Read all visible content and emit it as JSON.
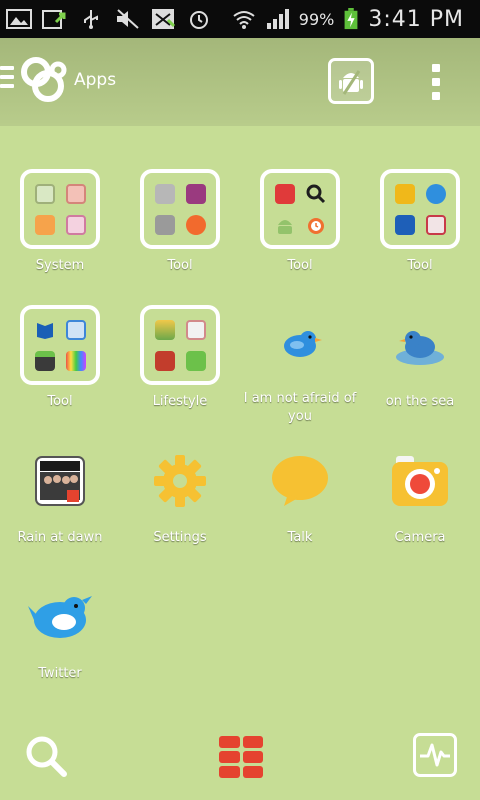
{
  "status_bar": {
    "battery": "99%",
    "time": "3:41 PM",
    "icons": [
      "gallery-icon",
      "upload-icon",
      "usb-icon",
      "mute-icon",
      "notification-icon",
      "alarm-icon",
      "wifi-icon",
      "signal-icon",
      "battery-charging-icon"
    ]
  },
  "action_bar": {
    "title": "Apps",
    "icons": [
      "menu-icon",
      "go-launcher-logo-icon",
      "app-store-icon",
      "overflow-menu-icon"
    ]
  },
  "apps": [
    {
      "label": "System",
      "kind": "folder",
      "minis": [
        "#d9e8c4",
        "#f3c1b7",
        "#f6a34b",
        "#f4d2e0"
      ]
    },
    {
      "label": "Tool",
      "kind": "folder",
      "minis": [
        "#b7b7b7",
        "#9a3a7f",
        "#9a9a9a",
        "#f26a2d"
      ]
    },
    {
      "label": "Tool",
      "kind": "folder",
      "minis": [
        "#e03a3a",
        "#1e1e1e",
        "#93c36b",
        "#f07030"
      ]
    },
    {
      "label": "Tool",
      "kind": "folder",
      "minis": [
        "#f0b81a",
        "#2f8fde",
        "#1e5fb8",
        "#c83a48"
      ]
    },
    {
      "label": "Tool",
      "kind": "folder",
      "minis": [
        "#1a5fb6",
        "#3d86d8",
        "#3a3a3a",
        "#d8d8d8"
      ]
    },
    {
      "label": "Lifestyle",
      "kind": "folder",
      "minis": [
        "#e0b633",
        "#e2a0a0",
        "#c23d2c",
        "#6cc14a"
      ]
    },
    {
      "label": "I am not afraid of you",
      "kind": "app",
      "icon": "blue-bird-icon"
    },
    {
      "label": "on the sea",
      "kind": "app",
      "icon": "sea-bird-icon"
    },
    {
      "label": "Rain at dawn",
      "kind": "app",
      "icon": "cnblue-theme-icon"
    },
    {
      "label": "Settings",
      "kind": "app",
      "icon": "gear-icon"
    },
    {
      "label": "Talk",
      "kind": "app",
      "icon": "speech-bubble-icon"
    },
    {
      "label": "Camera",
      "kind": "app",
      "icon": "camera-icon"
    },
    {
      "label": "Twitter",
      "kind": "app",
      "icon": "twitter-bird-icon"
    }
  ],
  "dock": {
    "icons": [
      "search-icon",
      "app-drawer-icon",
      "activity-icon"
    ]
  },
  "colors": {
    "background": "#c6dd95",
    "status_bar": "#0b0b0b",
    "accent_red": "#e5432f",
    "bird_blue": "#2f8fde",
    "settings_yellow": "#f6c132"
  }
}
